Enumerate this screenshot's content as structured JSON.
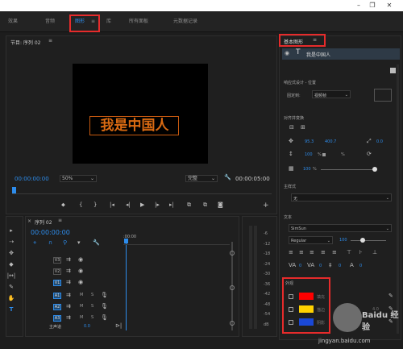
{
  "workspaces": {
    "tabs": [
      "效果",
      "音频",
      "图形",
      "库",
      "所有面板",
      "元数据记录"
    ],
    "active": "图形"
  },
  "program_monitor": {
    "title": "节目: 序列 02",
    "title_text": "我是中国人",
    "timecode_left": "00:00:00:00",
    "zoom": "50%",
    "quality": "完整",
    "timecode_right": "00:00:05:00"
  },
  "timeline": {
    "title": "序列 02",
    "timecode": "00:00:00:00",
    "ruler_label": ":00:00",
    "video_tracks": [
      "V3",
      "V2",
      "V1"
    ],
    "audio_tracks": [
      "A1",
      "A2",
      "A3"
    ],
    "master_label": "主声道",
    "master_value": "0.0",
    "track_toggles": [
      "M",
      "S"
    ]
  },
  "meter": {
    "scale": [
      "-6",
      "-12",
      "-18",
      "-24",
      "-30",
      "-36",
      "-42",
      "-48",
      "-54",
      "dB"
    ]
  },
  "essential_graphics": {
    "title": "基本图形",
    "layer_name": "我是中国人",
    "responsive_label": "响应式设计 - 位置",
    "pin_label": "固定到:",
    "pin_value": "视频帧",
    "align_label": "对齐并变换",
    "pos_x": "95.3",
    "pos_y": "400.7",
    "rotation": "0.0",
    "scale": "100",
    "scale_unit": "%",
    "opacity": "100",
    "opacity_unit": "%",
    "master_style_label": "主样式",
    "master_style_value": "无",
    "text_label": "文本",
    "font": "SimSun",
    "font_style": "Regular",
    "font_size": "100",
    "text_metrics": [
      "0",
      "0",
      "0",
      "0"
    ],
    "appearance_label": "外观",
    "fill_label": "填充",
    "stroke_label": "描边",
    "stroke_value": "4.0",
    "shadow_label": "阴影"
  },
  "colors": {
    "accent": "#2d8ceb",
    "highlight": "#e62b2b",
    "title_fill": "#d96a12",
    "fill_swatch": "#ff0000",
    "stroke_swatch": "#ffd200",
    "shadow_swatch": "#1a48d6"
  },
  "watermark": {
    "text": "Baidu 经验",
    "url": "jingyan.baidu.com"
  }
}
